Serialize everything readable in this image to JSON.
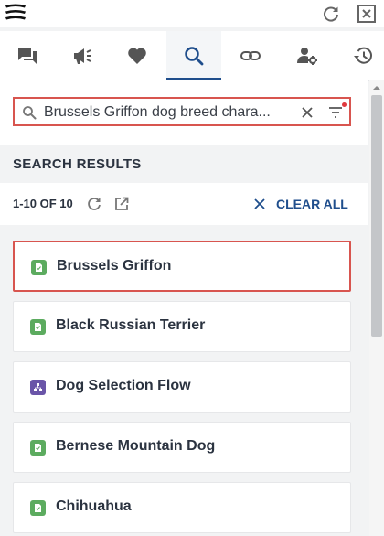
{
  "window": {
    "menu_icon": "hamburger-stack-icon",
    "refresh_icon": "refresh-icon",
    "close_icon": "close-box-icon"
  },
  "tabs": [
    {
      "icon": "chat-icon",
      "active": false
    },
    {
      "icon": "megaphone-icon",
      "active": false
    },
    {
      "icon": "heart-icon",
      "active": false
    },
    {
      "icon": "search-icon",
      "active": true
    },
    {
      "icon": "link-icon",
      "active": false
    },
    {
      "icon": "user-settings-icon",
      "active": false
    },
    {
      "icon": "history-icon",
      "active": false
    }
  ],
  "search": {
    "value": "Brussels Griffon dog breed chara...",
    "has_active_filter": true
  },
  "results": {
    "header": "SEARCH RESULTS",
    "count": "1-10 OF 10",
    "clear_all": "CLEAR ALL",
    "items": [
      {
        "title": "Brussels Griffon",
        "type": "article",
        "selected": true
      },
      {
        "title": "Black Russian Terrier",
        "type": "article",
        "selected": false
      },
      {
        "title": "Dog Selection Flow",
        "type": "flow",
        "selected": false
      },
      {
        "title": "Bernese Mountain Dog",
        "type": "article",
        "selected": false
      },
      {
        "title": "Chihuahua",
        "type": "article",
        "selected": false
      }
    ]
  },
  "colors": {
    "accent": "#1f4e8c",
    "highlight_border": "#d8554f",
    "article_badge": "#5cab5f",
    "flow_badge": "#6a55a8",
    "filter_dot": "#e0393e"
  }
}
